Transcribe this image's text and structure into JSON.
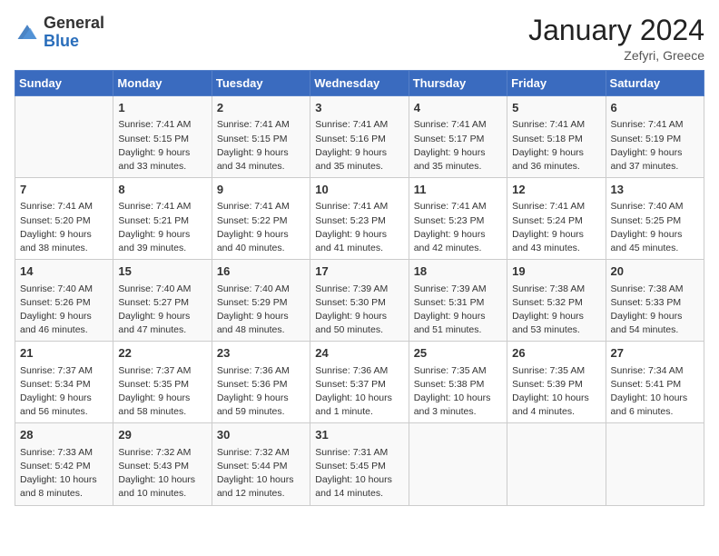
{
  "header": {
    "logo_general": "General",
    "logo_blue": "Blue",
    "month_title": "January 2024",
    "location": "Zefyri, Greece"
  },
  "weekdays": [
    "Sunday",
    "Monday",
    "Tuesday",
    "Wednesday",
    "Thursday",
    "Friday",
    "Saturday"
  ],
  "weeks": [
    [
      {
        "day": "",
        "sunrise": "",
        "sunset": "",
        "daylight": ""
      },
      {
        "day": "1",
        "sunrise": "7:41 AM",
        "sunset": "5:15 PM",
        "daylight": "9 hours and 33 minutes."
      },
      {
        "day": "2",
        "sunrise": "7:41 AM",
        "sunset": "5:15 PM",
        "daylight": "9 hours and 34 minutes."
      },
      {
        "day": "3",
        "sunrise": "7:41 AM",
        "sunset": "5:16 PM",
        "daylight": "9 hours and 35 minutes."
      },
      {
        "day": "4",
        "sunrise": "7:41 AM",
        "sunset": "5:17 PM",
        "daylight": "9 hours and 35 minutes."
      },
      {
        "day": "5",
        "sunrise": "7:41 AM",
        "sunset": "5:18 PM",
        "daylight": "9 hours and 36 minutes."
      },
      {
        "day": "6",
        "sunrise": "7:41 AM",
        "sunset": "5:19 PM",
        "daylight": "9 hours and 37 minutes."
      }
    ],
    [
      {
        "day": "7",
        "sunrise": "7:41 AM",
        "sunset": "5:20 PM",
        "daylight": "9 hours and 38 minutes."
      },
      {
        "day": "8",
        "sunrise": "7:41 AM",
        "sunset": "5:21 PM",
        "daylight": "9 hours and 39 minutes."
      },
      {
        "day": "9",
        "sunrise": "7:41 AM",
        "sunset": "5:22 PM",
        "daylight": "9 hours and 40 minutes."
      },
      {
        "day": "10",
        "sunrise": "7:41 AM",
        "sunset": "5:23 PM",
        "daylight": "9 hours and 41 minutes."
      },
      {
        "day": "11",
        "sunrise": "7:41 AM",
        "sunset": "5:23 PM",
        "daylight": "9 hours and 42 minutes."
      },
      {
        "day": "12",
        "sunrise": "7:41 AM",
        "sunset": "5:24 PM",
        "daylight": "9 hours and 43 minutes."
      },
      {
        "day": "13",
        "sunrise": "7:40 AM",
        "sunset": "5:25 PM",
        "daylight": "9 hours and 45 minutes."
      }
    ],
    [
      {
        "day": "14",
        "sunrise": "7:40 AM",
        "sunset": "5:26 PM",
        "daylight": "9 hours and 46 minutes."
      },
      {
        "day": "15",
        "sunrise": "7:40 AM",
        "sunset": "5:27 PM",
        "daylight": "9 hours and 47 minutes."
      },
      {
        "day": "16",
        "sunrise": "7:40 AM",
        "sunset": "5:29 PM",
        "daylight": "9 hours and 48 minutes."
      },
      {
        "day": "17",
        "sunrise": "7:39 AM",
        "sunset": "5:30 PM",
        "daylight": "9 hours and 50 minutes."
      },
      {
        "day": "18",
        "sunrise": "7:39 AM",
        "sunset": "5:31 PM",
        "daylight": "9 hours and 51 minutes."
      },
      {
        "day": "19",
        "sunrise": "7:38 AM",
        "sunset": "5:32 PM",
        "daylight": "9 hours and 53 minutes."
      },
      {
        "day": "20",
        "sunrise": "7:38 AM",
        "sunset": "5:33 PM",
        "daylight": "9 hours and 54 minutes."
      }
    ],
    [
      {
        "day": "21",
        "sunrise": "7:37 AM",
        "sunset": "5:34 PM",
        "daylight": "9 hours and 56 minutes."
      },
      {
        "day": "22",
        "sunrise": "7:37 AM",
        "sunset": "5:35 PM",
        "daylight": "9 hours and 58 minutes."
      },
      {
        "day": "23",
        "sunrise": "7:36 AM",
        "sunset": "5:36 PM",
        "daylight": "9 hours and 59 minutes."
      },
      {
        "day": "24",
        "sunrise": "7:36 AM",
        "sunset": "5:37 PM",
        "daylight": "10 hours and 1 minute."
      },
      {
        "day": "25",
        "sunrise": "7:35 AM",
        "sunset": "5:38 PM",
        "daylight": "10 hours and 3 minutes."
      },
      {
        "day": "26",
        "sunrise": "7:35 AM",
        "sunset": "5:39 PM",
        "daylight": "10 hours and 4 minutes."
      },
      {
        "day": "27",
        "sunrise": "7:34 AM",
        "sunset": "5:41 PM",
        "daylight": "10 hours and 6 minutes."
      }
    ],
    [
      {
        "day": "28",
        "sunrise": "7:33 AM",
        "sunset": "5:42 PM",
        "daylight": "10 hours and 8 minutes."
      },
      {
        "day": "29",
        "sunrise": "7:32 AM",
        "sunset": "5:43 PM",
        "daylight": "10 hours and 10 minutes."
      },
      {
        "day": "30",
        "sunrise": "7:32 AM",
        "sunset": "5:44 PM",
        "daylight": "10 hours and 12 minutes."
      },
      {
        "day": "31",
        "sunrise": "7:31 AM",
        "sunset": "5:45 PM",
        "daylight": "10 hours and 14 minutes."
      },
      {
        "day": "",
        "sunrise": "",
        "sunset": "",
        "daylight": ""
      },
      {
        "day": "",
        "sunrise": "",
        "sunset": "",
        "daylight": ""
      },
      {
        "day": "",
        "sunrise": "",
        "sunset": "",
        "daylight": ""
      }
    ]
  ]
}
